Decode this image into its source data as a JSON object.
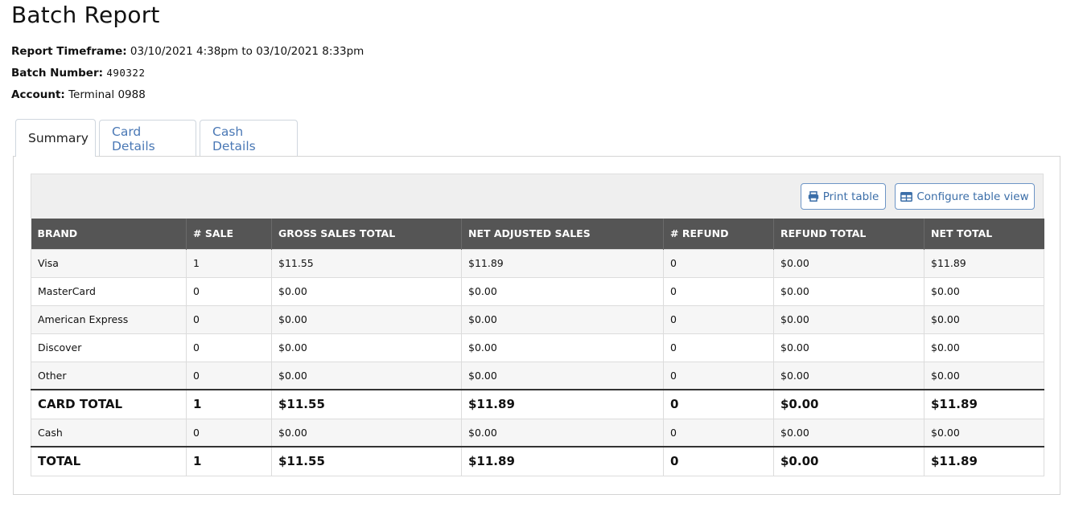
{
  "page": {
    "title": "Batch Report",
    "meta": [
      {
        "label": "Report Timeframe:",
        "value": "03/10/2021 4:38pm to 03/10/2021 8:33pm"
      },
      {
        "label": "Batch Number:",
        "value": "490322"
      },
      {
        "label": "Account:",
        "value": "Terminal 0988"
      }
    ]
  },
  "tabs": [
    {
      "label": "Summary",
      "active": true
    },
    {
      "label": "Card Details",
      "active": false
    },
    {
      "label": "Cash Details",
      "active": false
    }
  ],
  "toolbar": {
    "print_label": "Print table",
    "print_icon": "printer-icon",
    "config_label": "Configure table view",
    "config_icon": "table-layout-icon"
  },
  "colors": {
    "header_bg": "#555555",
    "link": "#4a78b5",
    "button_border": "#6d95c6"
  },
  "table": {
    "columns": [
      "BRAND",
      "# SALE",
      "GROSS SALES TOTAL",
      "NET ADJUSTED SALES",
      "# REFUND",
      "REFUND TOTAL",
      "NET TOTAL"
    ],
    "rows": [
      {
        "cells": [
          "Visa",
          "1",
          "$11.55",
          "$11.89",
          "0",
          "$0.00",
          "$11.89"
        ],
        "total": false
      },
      {
        "cells": [
          "MasterCard",
          "0",
          "$0.00",
          "$0.00",
          "0",
          "$0.00",
          "$0.00"
        ],
        "total": false
      },
      {
        "cells": [
          "American Express",
          "0",
          "$0.00",
          "$0.00",
          "0",
          "$0.00",
          "$0.00"
        ],
        "total": false
      },
      {
        "cells": [
          "Discover",
          "0",
          "$0.00",
          "$0.00",
          "0",
          "$0.00",
          "$0.00"
        ],
        "total": false
      },
      {
        "cells": [
          "Other",
          "0",
          "$0.00",
          "$0.00",
          "0",
          "$0.00",
          "$0.00"
        ],
        "total": false
      },
      {
        "cells": [
          "CARD TOTAL",
          "1",
          "$11.55",
          "$11.89",
          "0",
          "$0.00",
          "$11.89"
        ],
        "total": true
      },
      {
        "cells": [
          "Cash",
          "0",
          "$0.00",
          "$0.00",
          "0",
          "$0.00",
          "$0.00"
        ],
        "total": false
      },
      {
        "cells": [
          "TOTAL",
          "1",
          "$11.55",
          "$11.89",
          "0",
          "$0.00",
          "$11.89"
        ],
        "total": true
      }
    ]
  }
}
